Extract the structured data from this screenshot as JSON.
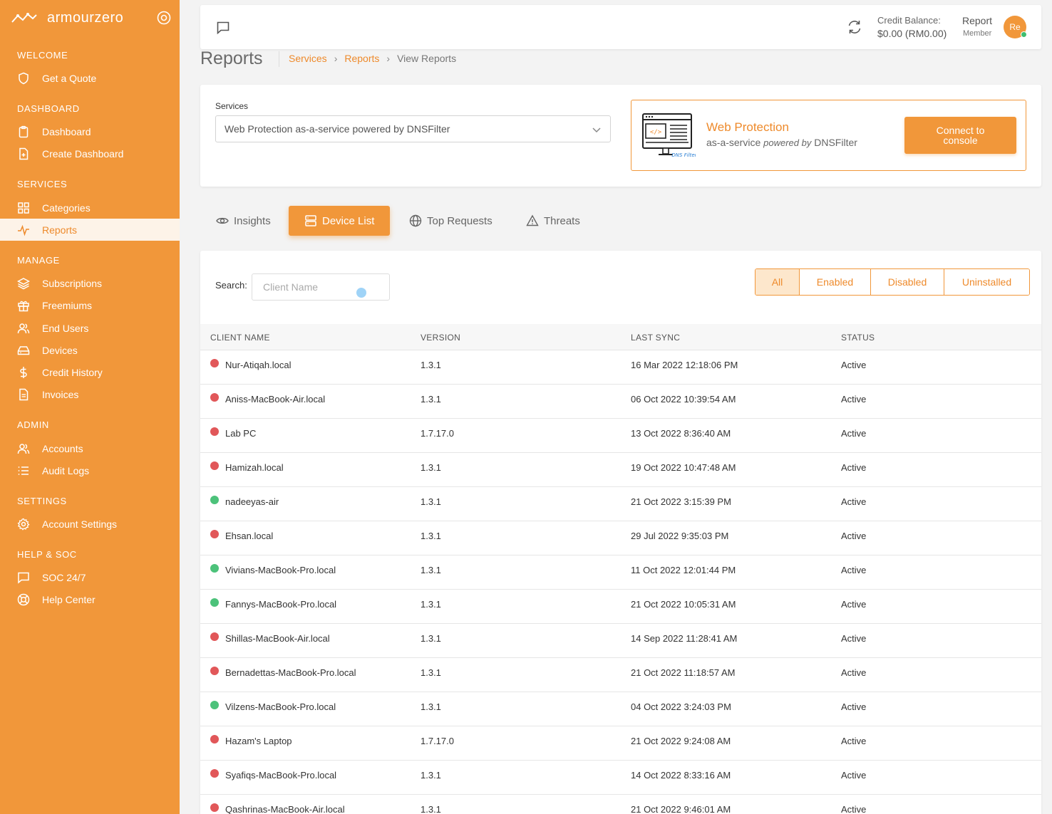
{
  "brand": {
    "name": "armourzero"
  },
  "sidebar": {
    "sections": {
      "welcome": "WELCOME",
      "dashboard": "DASHBOARD",
      "services": "SERVICES",
      "manage": "MANAGE",
      "admin": "ADMIN",
      "settings": "SETTINGS",
      "help": "HELP & SOC"
    },
    "items": {
      "get_quote": "Get a Quote",
      "dashboard": "Dashboard",
      "create_dashboard": "Create Dashboard",
      "categories": "Categories",
      "reports": "Reports",
      "subscriptions": "Subscriptions",
      "freemiums": "Freemiums",
      "end_users": "End Users",
      "devices": "Devices",
      "credit_history": "Credit History",
      "invoices": "Invoices",
      "accounts": "Accounts",
      "audit_logs": "Audit Logs",
      "account_settings": "Account Settings",
      "soc": "SOC 24/7",
      "help_center": "Help Center"
    }
  },
  "header": {
    "credit_label": "Credit Balance:",
    "credit_value": "$0.00 (RM0.00)",
    "user_name": "Report",
    "user_role": "Member",
    "avatar_initials": "Re"
  },
  "page": {
    "title": "Reports",
    "breadcrumb": [
      "Services",
      "Reports",
      "View Reports"
    ]
  },
  "services": {
    "label": "Services",
    "selected": "Web Protection as-a-service powered by DNSFilter",
    "promo_title": "Web Protection",
    "promo_sub_pre": "as-a-service",
    "promo_sub_powered": "powered by",
    "promo_sub_brand": "DNSFilter",
    "connect_label": "Connect to console",
    "illus_text": "DNS Filter"
  },
  "tabs": [
    "Insights",
    "Device List",
    "Top Requests",
    "Threats"
  ],
  "search": {
    "label": "Search:",
    "placeholder": "Client Name"
  },
  "filters": [
    "All",
    "Enabled",
    "Disabled",
    "Uninstalled"
  ],
  "table": {
    "columns": [
      "CLIENT NAME",
      "VERSION",
      "LAST SYNC",
      "STATUS"
    ],
    "rows": [
      {
        "name": "Nur-Atiqah.local",
        "version": "1.3.1",
        "last_sync": "16 Mar 2022 12:18:06 PM",
        "status": "Active",
        "dot": "red"
      },
      {
        "name": "Aniss-MacBook-Air.local",
        "version": "1.3.1",
        "last_sync": "06 Oct 2022 10:39:54 AM",
        "status": "Active",
        "dot": "red"
      },
      {
        "name": "Lab PC",
        "version": "1.7.17.0",
        "last_sync": "13 Oct 2022 8:36:40 AM",
        "status": "Active",
        "dot": "red"
      },
      {
        "name": "Hamizah.local",
        "version": "1.3.1",
        "last_sync": "19 Oct 2022 10:47:48 AM",
        "status": "Active",
        "dot": "red"
      },
      {
        "name": "nadeeyas-air",
        "version": "1.3.1",
        "last_sync": "21 Oct 2022 3:15:39 PM",
        "status": "Active",
        "dot": "green"
      },
      {
        "name": "Ehsan.local",
        "version": "1.3.1",
        "last_sync": "29 Jul 2022 9:35:03 PM",
        "status": "Active",
        "dot": "red"
      },
      {
        "name": "Vivians-MacBook-Pro.local",
        "version": "1.3.1",
        "last_sync": "11 Oct 2022 12:01:44 PM",
        "status": "Active",
        "dot": "green"
      },
      {
        "name": "Fannys-MacBook-Pro.local",
        "version": "1.3.1",
        "last_sync": "21 Oct 2022 10:05:31 AM",
        "status": "Active",
        "dot": "green"
      },
      {
        "name": "Shillas-MacBook-Air.local",
        "version": "1.3.1",
        "last_sync": "14 Sep 2022 11:28:41 AM",
        "status": "Active",
        "dot": "red"
      },
      {
        "name": "Bernadettas-MacBook-Pro.local",
        "version": "1.3.1",
        "last_sync": "21 Oct 2022 11:18:57 AM",
        "status": "Active",
        "dot": "red"
      },
      {
        "name": "Vilzens-MacBook-Pro.local",
        "version": "1.3.1",
        "last_sync": "04 Oct 2022 3:24:03 PM",
        "status": "Active",
        "dot": "green"
      },
      {
        "name": "Hazam's Laptop",
        "version": "1.7.17.0",
        "last_sync": "21 Oct 2022 9:24:08 AM",
        "status": "Active",
        "dot": "red"
      },
      {
        "name": "Syafiqs-MacBook-Pro.local",
        "version": "1.3.1",
        "last_sync": "14 Oct 2022 8:33:16 AM",
        "status": "Active",
        "dot": "red"
      },
      {
        "name": "Qashrinas-MacBook-Air.local",
        "version": "1.3.1",
        "last_sync": "21 Oct 2022 9:46:01 AM",
        "status": "Active",
        "dot": "red"
      }
    ]
  },
  "colors": {
    "brand_orange": "#f1973a",
    "dot_red": "#e15759",
    "dot_green": "#4cc27a"
  }
}
